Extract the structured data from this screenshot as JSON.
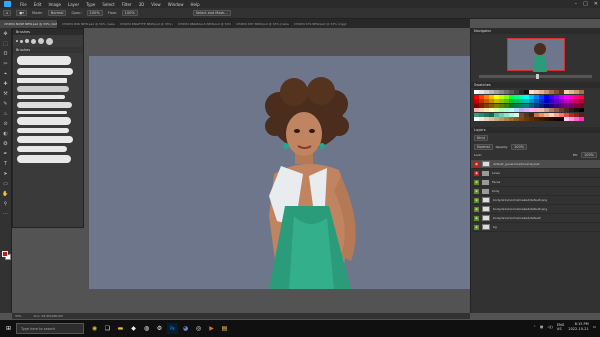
{
  "menubar": {
    "items": [
      "File",
      "Edit",
      "Image",
      "Layer",
      "Type",
      "Select",
      "Filter",
      "3D",
      "View",
      "Window",
      "Help"
    ],
    "window_controls": [
      "–",
      "□",
      "✕"
    ]
  },
  "options_bar": {
    "mode_label": "Mode:",
    "mode_value": "Normal",
    "opacity_label": "Opac:",
    "opacity_value": "100%",
    "flow_label": "Flow:",
    "flow_value": "100%",
    "select_subject": "Select and Mask..."
  },
  "tabs": [
    {
      "label": "CH4M4 NOSE NEW.psd @ 33% (default_generic/set/overlay/set...",
      "active": true
    },
    {
      "label": "CH4M4 #06 NEW.psd @ 50% (naked, RGB/8)",
      "active": false
    },
    {
      "label": "CH4M4 RNGETTE NEW.psd @ 33% (faces, RGB/8)",
      "active": false
    },
    {
      "label": "CH4M4 RNGBALLS NEW.psd @ 50% (eyes, RGB/8)",
      "active": false
    },
    {
      "label": "CH4M4 SHY NEW.psd @ 33% (naked, pregnant belly)",
      "active": false
    },
    {
      "label": "CH4M4 SYS NEW.psd @ 33% (rigging, RGB/8)",
      "active": false
    }
  ],
  "tools": [
    "✥",
    "⬚",
    "ʘ",
    "✂",
    "⌖",
    "✚",
    "⚒",
    "✎",
    "♨",
    "⊘",
    "◐",
    "❂",
    "✒",
    "T",
    "➤",
    "▭",
    "✋",
    "⚲",
    "⋯"
  ],
  "brushes_panel": {
    "title": "Brushes",
    "group_label": "Brushes"
  },
  "navigator": {
    "title": "Navigator"
  },
  "swatches": {
    "title": "Swatches",
    "colors": [
      "#f8f8f8",
      "#e6e6e6",
      "#d0d0d0",
      "#b8b8b8",
      "#a0a0a0",
      "#888",
      "#707070",
      "#585858",
      "#404040",
      "#282828",
      "#101010",
      "#ffe0d0",
      "#f5c9b0",
      "#e8b090",
      "#c98f6e",
      "#a66e4f",
      "#834f35",
      "#5f3421",
      "#f1d2b5",
      "#e0b890",
      "#c79a70",
      "#9e7450",
      "#ff0000",
      "#ff4000",
      "#ff8000",
      "#ffbf00",
      "#ffff00",
      "#bfff00",
      "#80ff00",
      "#00ff40",
      "#00ff80",
      "#00ffbf",
      "#00ffff",
      "#00bfff",
      "#0080ff",
      "#0040ff",
      "#0000ff",
      "#4000ff",
      "#8000ff",
      "#bf00ff",
      "#ff00ff",
      "#ff00bf",
      "#ff0080",
      "#ff0040",
      "#c00000",
      "#c03000",
      "#c06000",
      "#c09000",
      "#c0c000",
      "#90c000",
      "#60c000",
      "#00c030",
      "#00c060",
      "#00c090",
      "#00c0c0",
      "#0090c0",
      "#0060c0",
      "#0030c0",
      "#0000c0",
      "#3000c0",
      "#6000c0",
      "#9000c0",
      "#c000c0",
      "#c00090",
      "#c00060",
      "#c00030",
      "#800000",
      "#802000",
      "#804000",
      "#806000",
      "#808000",
      "#608000",
      "#408000",
      "#008020",
      "#008040",
      "#008060",
      "#008080",
      "#006080",
      "#004080",
      "#002080",
      "#000080",
      "#200080",
      "#400080",
      "#600080",
      "#800080",
      "#800060",
      "#800040",
      "#800020",
      "#ffb3b3",
      "#ffd0b3",
      "#ffe6b3",
      "#ffffb3",
      "#d9ffb3",
      "#b3ffb3",
      "#b3ffd9",
      "#b3ffff",
      "#b3d9ff",
      "#b3b3ff",
      "#d9b3ff",
      "#ffb3ff",
      "#ffb3d9",
      "#e8c3b0",
      "#c9a08c",
      "#b07860",
      "#8e5a44",
      "#6b3e2c",
      "#4a2a1e",
      "#2e1a12",
      "#1a0f0a",
      "#000000",
      "#3a9c7c",
      "#2e8a6c",
      "#23785c",
      "#18664c",
      "#4ab896",
      "#6cd0b0",
      "#8ee4c8",
      "#b0f0dc",
      "#d2f8ec",
      "#7a4a2e",
      "#5a341f",
      "#3e2314",
      "#c2714a",
      "#e89468",
      "#f4b690",
      "#ffd4b8",
      "#ff9d9d",
      "#ff7070",
      "#e04848",
      "#b82828",
      "#902020",
      "#681818",
      "#fcfcfc",
      "#f0e8dc",
      "#e4d4be",
      "#d6c0a0",
      "#c8ac84",
      "#b89868",
      "#a8844e",
      "#987038",
      "#885c24",
      "#784a14",
      "#683a08",
      "#5a2e04",
      "#4c2402",
      "#3e1c00",
      "#301400",
      "#220e00",
      "#160800",
      "#0c0400",
      "#ffccee",
      "#ff99dd",
      "#ff66cc",
      "#ff33bb"
    ]
  },
  "layers": {
    "title": "Layers",
    "kind_label": "Kind",
    "blend_value": "Normal",
    "opacity_label": "Opacity:",
    "opacity_value": "100%",
    "lock_label": "Lock:",
    "fill_label": "Fill:",
    "fill_value": "100%",
    "items": [
      {
        "name": "default_generic/set/overlay/set",
        "type": "layer",
        "selected": true
      },
      {
        "name": "Lines",
        "type": "folder",
        "selected": false
      },
      {
        "name": "Faces",
        "type": "folder",
        "selected": false
      },
      {
        "name": "body",
        "type": "folder",
        "selected": false
      },
      {
        "name": "body/skin/normal/naked/default.png",
        "type": "layer",
        "selected": false
      },
      {
        "name": "body/skin/normal/naked/default.png",
        "type": "layer",
        "selected": false
      },
      {
        "name": "body/skin/normal/naked/default",
        "type": "layer",
        "selected": false
      },
      {
        "name": "bg",
        "type": "layer",
        "selected": false
      }
    ]
  },
  "statusbar": {
    "zoom": "33%",
    "doc": "Doc: 28.9M/280.6M"
  },
  "taskbar": {
    "search_placeholder": "Type here to search",
    "lang": "ENG",
    "region": "US",
    "time": "8:15 PM",
    "date": "2022-10-21"
  }
}
